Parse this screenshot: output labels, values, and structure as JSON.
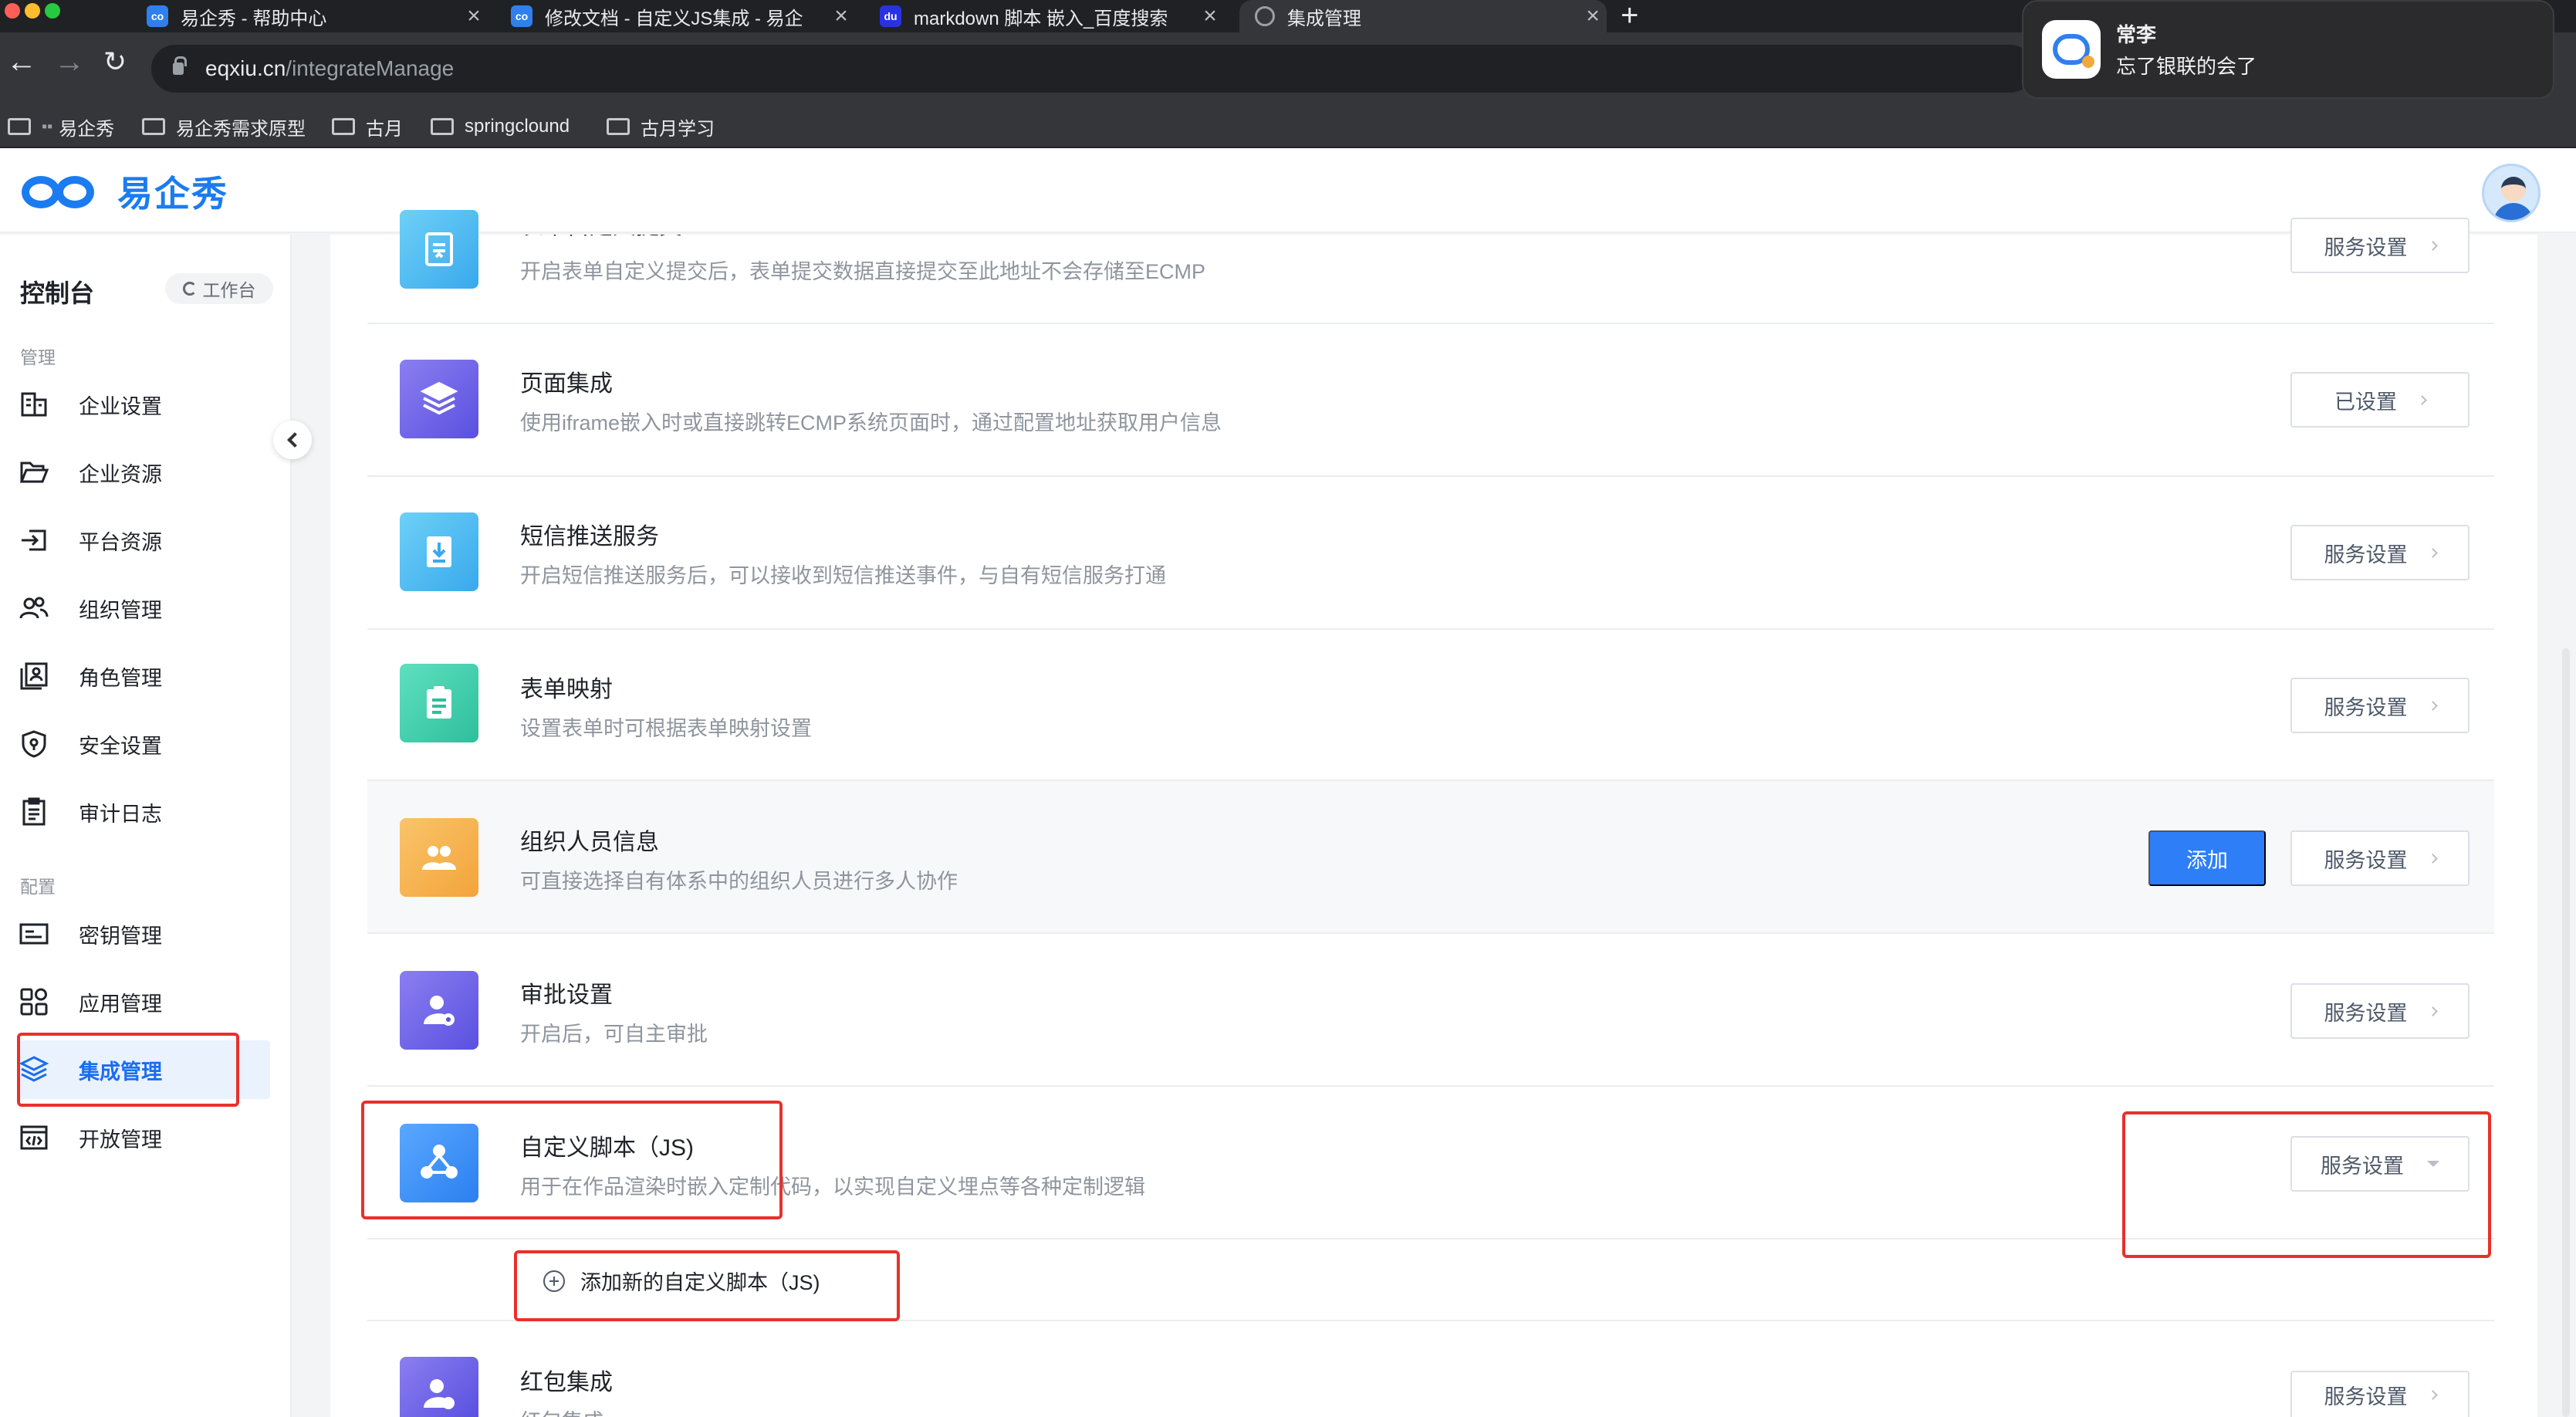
{
  "browser": {
    "tabs": [
      {
        "title": "易企秀 - 帮助中心",
        "favicon": "eqxiu-favicon"
      },
      {
        "title": "修改文档 - 自定义JS集成 - 易企",
        "favicon": "eqxiu-favicon"
      },
      {
        "title": "markdown 脚本 嵌入_百度搜索",
        "favicon": "baidu-favicon"
      },
      {
        "title": "集成管理",
        "favicon": "globe-icon"
      }
    ],
    "address": {
      "host": "eqxiu.cn",
      "path": "/integrateManage"
    },
    "bookmarks": [
      "易企秀",
      "易企秀需求原型",
      "古月",
      "springclound",
      "古月学习"
    ]
  },
  "notification": {
    "sender": "常李",
    "message": "忘了银联的会了"
  },
  "app": {
    "logo_text": "易企秀",
    "colors": {
      "brand": "#1a7cf0",
      "primary_button": "#2d7ef7",
      "annotation": "#e8312a"
    }
  },
  "sidebar": {
    "title": "控制台",
    "workbench_label": "工作台",
    "sections": [
      {
        "label": "管理",
        "items": [
          {
            "label": "企业设置",
            "icon": "building-icon"
          },
          {
            "label": "企业资源",
            "icon": "folder-open-icon"
          },
          {
            "label": "平台资源",
            "icon": "import-icon"
          },
          {
            "label": "组织管理",
            "icon": "users-icon"
          },
          {
            "label": "角色管理",
            "icon": "role-icon"
          },
          {
            "label": "安全设置",
            "icon": "shield-icon"
          },
          {
            "label": "审计日志",
            "icon": "clipboard-icon"
          }
        ]
      },
      {
        "label": "配置",
        "items": [
          {
            "label": "密钥管理",
            "icon": "key-card-icon"
          },
          {
            "label": "应用管理",
            "icon": "apps-icon"
          },
          {
            "label": "集成管理",
            "icon": "layers-icon",
            "active": true
          },
          {
            "label": "开放管理",
            "icon": "code-icon"
          }
        ]
      }
    ]
  },
  "integrations": [
    {
      "title": "表单自定义提交",
      "desc": "开启表单自定义提交后，表单提交数据直接提交至此地址不会存储至ECMP",
      "button": "服务设置",
      "icon": "form-submit-icon"
    },
    {
      "title": "页面集成",
      "desc": "使用iframe嵌入时或直接跳转ECMP系统页面时，通过配置地址获取用户信息",
      "button": "已设置",
      "icon": "layers-icon"
    },
    {
      "title": "短信推送服务",
      "desc": "开启短信推送服务后，可以接收到短信推送事件，与自有短信服务打通",
      "button": "服务设置",
      "icon": "sms-icon"
    },
    {
      "title": "表单映射",
      "desc": "设置表单时可根据表单映射设置",
      "button": "服务设置",
      "icon": "form-map-icon"
    },
    {
      "title": "组织人员信息",
      "desc": "可直接选择自有体系中的组织人员进行多人协作",
      "button": "服务设置",
      "add_button": "添加",
      "icon": "team-icon"
    },
    {
      "title": "审批设置",
      "desc": "开启后，可自主审批",
      "button": "服务设置",
      "icon": "approval-icon"
    },
    {
      "title": "自定义脚本（JS)",
      "desc": "用于在作品渲染时嵌入定制代码，以实现自定义埋点等各种定制逻辑",
      "button": "服务设置",
      "icon": "script-icon",
      "expanded": true
    },
    {
      "title": "红包集成",
      "desc": "红包集成",
      "button": "服务设置",
      "icon": "redpacket-icon"
    }
  ],
  "add_script_label": "添加新的自定义脚本（JS)"
}
